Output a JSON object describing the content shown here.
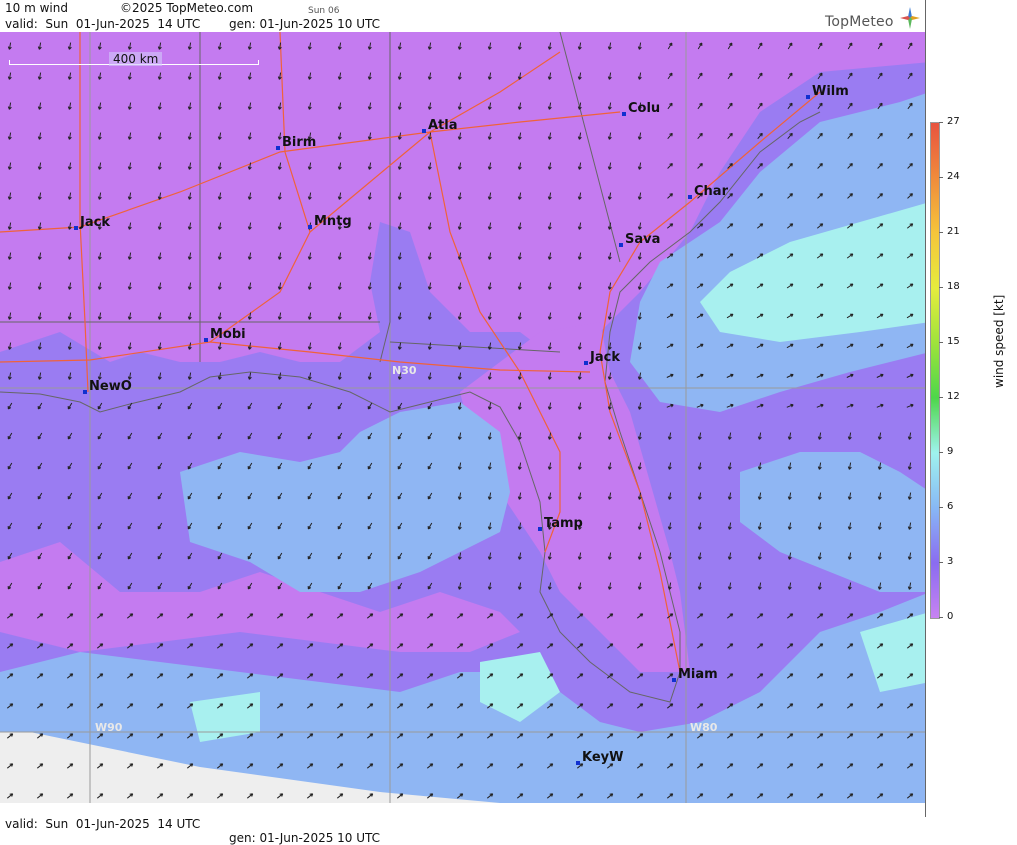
{
  "header": {
    "product": "10 m wind",
    "copyright": "©2025 TopMeteo.com",
    "day_label": "Sun 06",
    "valid": "valid:  Sun  01-Jun-2025  14 UTC",
    "gen": "gen: 01-Jun-2025 10 UTC"
  },
  "logo": {
    "text": "TopMeteo",
    "icon": "compass-star-icon"
  },
  "scale_bar": {
    "label": "400 km"
  },
  "grid_labels": {
    "n30": "N30",
    "w90": "W90",
    "w80": "W80"
  },
  "cities": [
    {
      "name": "Wilm"
    },
    {
      "name": "Colu"
    },
    {
      "name": "Atla"
    },
    {
      "name": "Birm"
    },
    {
      "name": "Char"
    },
    {
      "name": "Sava"
    },
    {
      "name": "Jack"
    },
    {
      "name": "Mntg"
    },
    {
      "name": "Mobi"
    },
    {
      "name": "Jack"
    },
    {
      "name": "NewO"
    },
    {
      "name": "Tamp"
    },
    {
      "name": "Miam"
    },
    {
      "name": "KeyW"
    }
  ],
  "footer": {
    "valid": "valid:  Sun  01-Jun-2025  14 UTC",
    "gen": "gen: 01-Jun-2025 10 UTC"
  },
  "colorbar": {
    "label": "wind speed [kt]",
    "ticks": [
      "27",
      "24",
      "21",
      "18",
      "15",
      "12",
      "9",
      "6",
      "3",
      "0"
    ],
    "colors": [
      "#e8533f",
      "#f08b3c",
      "#f5c53b",
      "#e6ec3e",
      "#9fe33b",
      "#4ed64b",
      "#9ff2ee",
      "#88b8f5",
      "#8a6cf0",
      "#c783f2"
    ]
  },
  "colors": {
    "calm": "#c47bf0",
    "light": "#9a7cf2",
    "moderate": "#8fb6f3",
    "fresh": "#a8f0ef",
    "no_data": "#eeeeee",
    "roads": "#f0623a",
    "city_marker": "#1030d0"
  }
}
